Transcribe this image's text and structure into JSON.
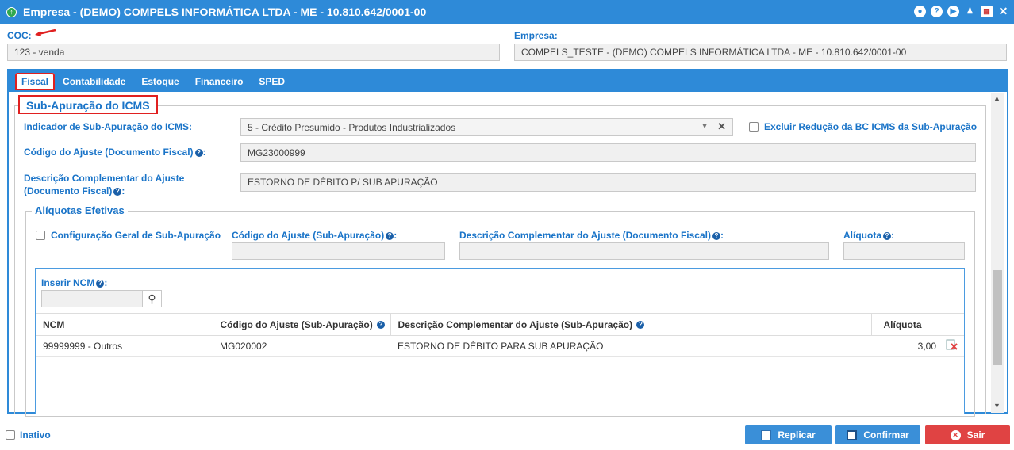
{
  "window": {
    "title": "Empresa - (DEMO) COMPELS INFORMÁTICA LTDA - ME - 10.810.642/0001-00"
  },
  "header": {
    "coc_label": "COC:",
    "coc_value": "123 - venda",
    "empresa_label": "Empresa:",
    "empresa_value": "COMPELS_TESTE - (DEMO) COMPELS INFORMÁTICA LTDA - ME - 10.810.642/0001-00"
  },
  "tabs": [
    {
      "label": "Fiscal"
    },
    {
      "label": "Contabilidade"
    },
    {
      "label": "Estoque"
    },
    {
      "label": "Financeiro"
    },
    {
      "label": "SPED"
    }
  ],
  "sub_apuracao": {
    "legend": "Sub-Apuração do ICMS",
    "indicador_label": "Indicador de Sub-Apuração do ICMS:",
    "indicador_value": "5 - Crédito Presumido - Produtos Industrializados",
    "excluir_label": "Excluir Redução da BC ICMS da Sub-Apuração",
    "codigo_label": "Código do Ajuste (Documento Fiscal)",
    "codigo_value": "MG23000999",
    "descricao_label_1": "Descrição Complementar do Ajuste",
    "descricao_label_2": "(Documento Fiscal)",
    "descricao_value": "ESTORNO DE DÉBITO P/ SUB APURAÇÃO"
  },
  "aliquotas": {
    "legend": "Alíquotas Efetivas",
    "config_label": "Configuração Geral de Sub-Apuração",
    "codigo_label": "Código do Ajuste (Sub-Apuração)",
    "descricao_label": "Descrição Complementar do Ajuste (Documento Fiscal)",
    "aliquota_label": "Alíquota",
    "inserir_ncm_label": "Inserir NCM"
  },
  "grid": {
    "columns": [
      "NCM",
      "Código do Ajuste (Sub-Apuração)",
      "Descrição Complementar do Ajuste (Sub-Apuração)",
      "Alíquota"
    ],
    "rows": [
      {
        "ncm": "99999999 - Outros",
        "codigo": "MG020002",
        "descricao": "ESTORNO DE DÉBITO PARA SUB APURAÇÃO",
        "aliquota": "3,00"
      }
    ]
  },
  "footer": {
    "inativo_label": "Inativo",
    "replicar_label": "Replicar",
    "confirmar_label": "Confirmar",
    "sair_label": "Sair"
  },
  "colors": {
    "primary": "#2e8ad8",
    "highlight": "#e02020",
    "danger": "#e04343"
  }
}
